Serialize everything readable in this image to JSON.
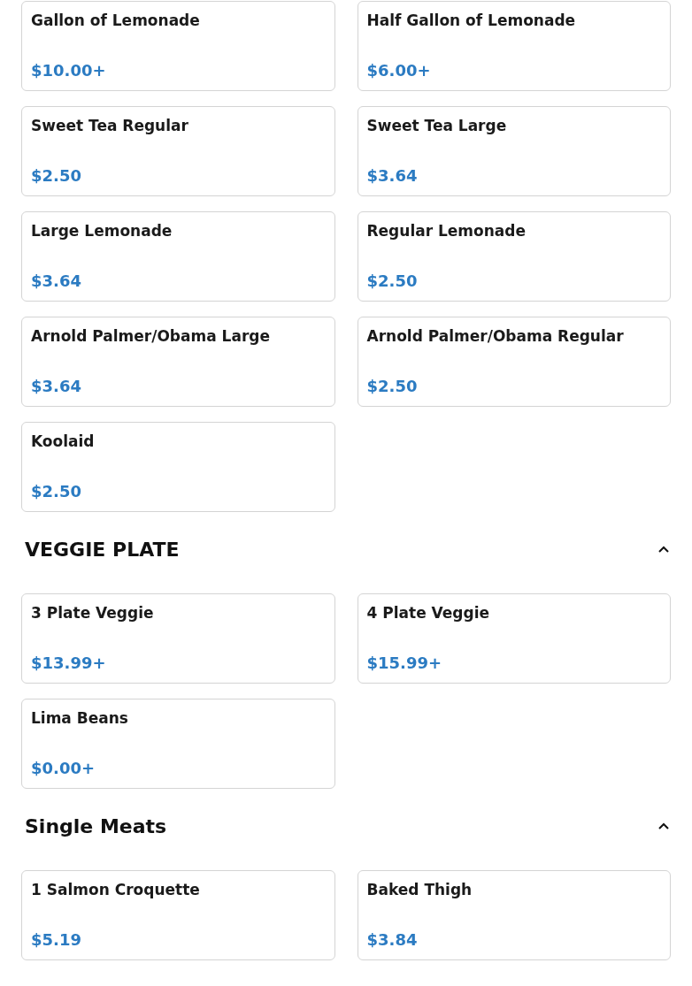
{
  "sections": [
    {
      "items": [
        {
          "name": "Gallon of Lemonade",
          "price": "$10.00+"
        },
        {
          "name": "Half Gallon of Lemonade",
          "price": "$6.00+"
        },
        {
          "name": "Sweet Tea Regular",
          "price": "$2.50"
        },
        {
          "name": "Sweet Tea Large",
          "price": "$3.64"
        },
        {
          "name": "Large Lemonade",
          "price": "$3.64"
        },
        {
          "name": "Regular Lemonade",
          "price": "$2.50"
        },
        {
          "name": "Arnold Palmer/Obama Large",
          "price": "$3.64"
        },
        {
          "name": "Arnold Palmer/Obama Regular",
          "price": "$2.50"
        },
        {
          "name": "Koolaid",
          "price": "$2.50"
        }
      ]
    },
    {
      "title": "VEGGIE PLATE",
      "expanded": true,
      "items": [
        {
          "name": "3 Plate Veggie",
          "price": "$13.99+"
        },
        {
          "name": "4 Plate Veggie",
          "price": "$15.99+"
        },
        {
          "name": "Lima Beans",
          "price": "$0.00+"
        }
      ]
    },
    {
      "title": "Single Meats",
      "expanded": true,
      "items": [
        {
          "name": "1 Salmon Croquette",
          "price": "$5.19"
        },
        {
          "name": "Baked Thigh",
          "price": "$3.84"
        }
      ]
    }
  ]
}
